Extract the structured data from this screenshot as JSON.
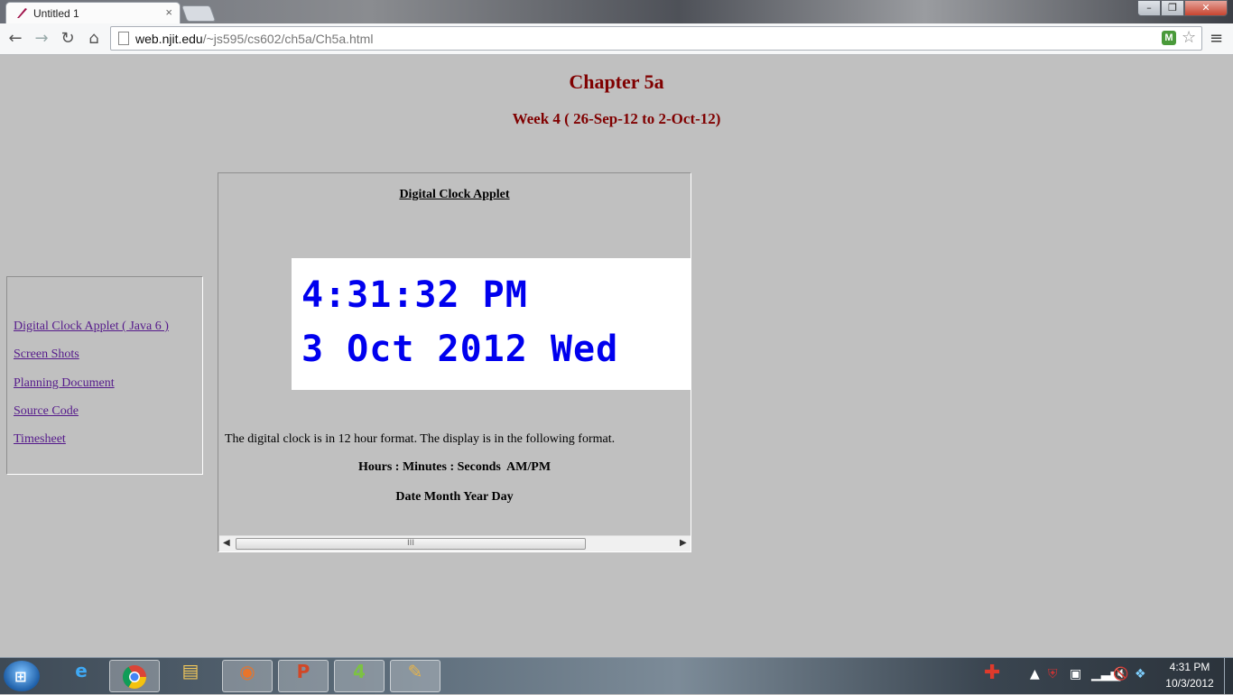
{
  "browser": {
    "tab_title": "Untitled 1",
    "tab_close": "×",
    "url_host": "web.njit.edu",
    "url_path": "/~js595/cs602/ch5a/Ch5a.html",
    "icons": [
      "back-icon",
      "forward-icon",
      "reload-icon",
      "home-icon",
      "page-icon",
      "extension-icon",
      "star-icon",
      "menu-icon"
    ]
  },
  "page": {
    "title": "Chapter 5a",
    "subtitle": "Week 4 ( 26-Sep-12 to 2-Oct-12)",
    "nav_links": [
      "Digital Clock Applet ( Java 6 )",
      "Screen Shots",
      "Planning Document",
      "Source Code",
      "Timesheet"
    ],
    "applet": {
      "heading": "Digital Clock Applet",
      "time_line": "4:31:32 PM",
      "date_line": "3 Oct 2012 Wed",
      "description": "The digital clock is in 12 hour format. The display is in the following format.",
      "format_time": "Hours : Minutes : Seconds  AM/PM",
      "format_date": "Date Month Year Day",
      "scroll_thumb_grip": "III"
    }
  },
  "taskbar": {
    "clock_time": "4:31 PM",
    "clock_date": "10/3/2012",
    "apps": [
      "start-button",
      "ie-icon",
      "chrome-icon",
      "explorer-icon",
      "firefox-icon",
      "powerpoint-icon",
      "app-icon",
      "paint-icon"
    ]
  },
  "colors": {
    "heading": "#800000",
    "clock_text": "#0000ee",
    "page_bg": "#c0c0c0",
    "link_visited": "#551a8b"
  }
}
